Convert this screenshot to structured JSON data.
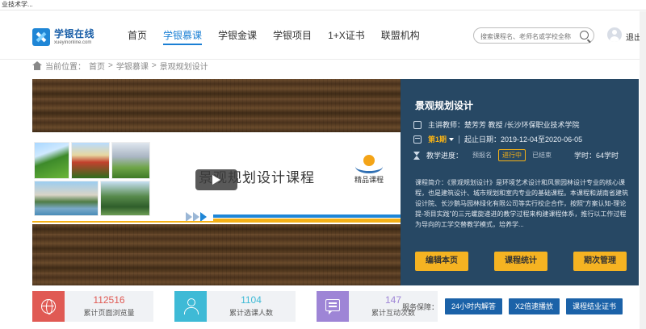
{
  "window": {
    "title_fragment": "业技术学..."
  },
  "header": {
    "logo": {
      "name": "学银在线",
      "sub": "xueyinonline.com"
    },
    "nav": [
      {
        "label": "首页",
        "active": false
      },
      {
        "label": "学银慕课",
        "active": true
      },
      {
        "label": "学银金课",
        "active": false
      },
      {
        "label": "学银项目",
        "active": false
      },
      {
        "label": "1+X证书",
        "active": false
      },
      {
        "label": "联盟机构",
        "active": false
      }
    ],
    "search_placeholder": "搜索课程名、老师名或学校全称",
    "logout": "退出"
  },
  "breadcrumb": {
    "prefix": "当前位置：",
    "items": [
      "首页",
      ">",
      "学银慕课",
      ">",
      "景观规划设计"
    ]
  },
  "banner": {
    "title": "景观规划设计课程",
    "badge": "精品课程"
  },
  "course": {
    "title": "景观规划设计",
    "teacher": "主讲教师：楚芳芳 教授 /长沙环保职业技术学院",
    "term": "第1期",
    "dates": "起止日期：2019-12-04至2020-06-05",
    "progress_label": "教学进度：",
    "progress_steps": [
      "预报名",
      "进行中",
      "已结束"
    ],
    "progress_current": "进行中",
    "hours": "学时：64学时",
    "description": "课程简介：《景观规划设计》是环境艺术设计和风景园林设计专业的核心课程，也是建筑设计、城市规划和室内专业的基础课程。本课程和湖南省建筑设计院、长沙鹅马园林绿化有限公司等实行校企合作，按照“方案认知-理论提-项目实践”的三元螺旋递进的教学过程来构建课程体系，推行以工作过程为导向的工学交替教学模式，培养学...",
    "buttons": [
      "编辑本页",
      "课程统计",
      "期次管理"
    ]
  },
  "stats": [
    {
      "value": "112516",
      "label": "累计页面浏览量",
      "color": "#e05a54",
      "icon": "globe-icon"
    },
    {
      "value": "1104",
      "label": "累计选课人数",
      "color": "#3ebad6",
      "icon": "users-icon"
    },
    {
      "value": "147",
      "label": "累计互动次数",
      "color": "#9e85d6",
      "icon": "chat-icon"
    }
  ],
  "service": {
    "label": "服务保障：",
    "items": [
      "24小时内解答",
      "X2倍速播放",
      "课程结业证书"
    ]
  }
}
